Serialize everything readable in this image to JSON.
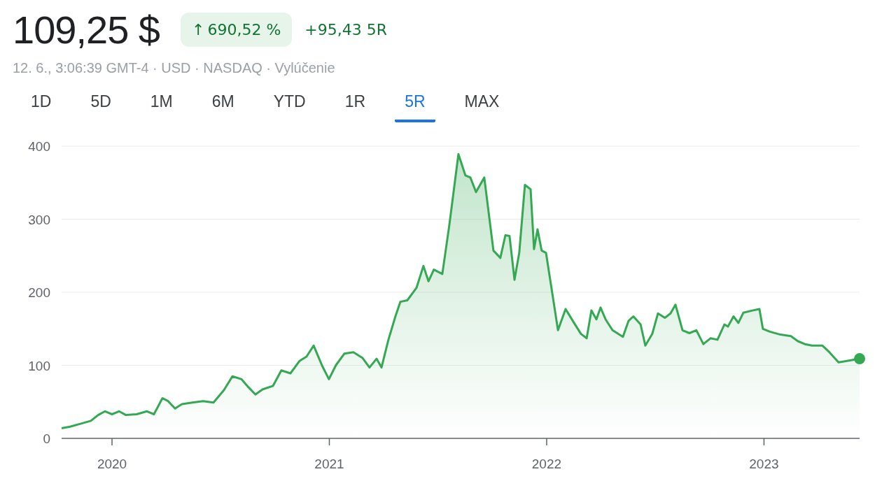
{
  "quote": {
    "price": "109,25 $",
    "change_percent": "690,52 %",
    "change_percent_arrow": "↑",
    "change_value": "+95,43 5R",
    "subtitle": "12. 6., 3:06:39 GMT-4 · USD · NASDAQ · Vylúčenie"
  },
  "tabs": [
    {
      "label": "1D",
      "selected": false
    },
    {
      "label": "5D",
      "selected": false
    },
    {
      "label": "1M",
      "selected": false
    },
    {
      "label": "6M",
      "selected": false
    },
    {
      "label": "YTD",
      "selected": false
    },
    {
      "label": "1R",
      "selected": false
    },
    {
      "label": "5R",
      "selected": true
    },
    {
      "label": "MAX",
      "selected": false
    }
  ],
  "chart": {
    "chart_data": {
      "type": "area",
      "grid": true,
      "xlim": [
        2019.768,
        2023.44
      ],
      "ylim": [
        0,
        400
      ],
      "yticks": [
        0,
        100,
        200,
        300,
        400
      ],
      "xticks": [
        2020,
        2021,
        2022,
        2023
      ],
      "x": [
        2019.768,
        2019.807,
        2019.855,
        2019.903,
        2019.936,
        2019.968,
        2020.0,
        2020.032,
        2020.064,
        2020.113,
        2020.161,
        2020.193,
        2020.232,
        2020.258,
        2020.29,
        2020.322,
        2020.37,
        2020.419,
        2020.467,
        2020.515,
        2020.554,
        2020.596,
        2020.628,
        2020.66,
        2020.692,
        2020.741,
        2020.779,
        2020.821,
        2020.863,
        2020.895,
        2020.928,
        2020.966,
        2020.998,
        2021.03,
        2021.069,
        2021.111,
        2021.153,
        2021.185,
        2021.217,
        2021.24,
        2021.272,
        2021.304,
        2021.327,
        2021.359,
        2021.401,
        2021.433,
        2021.456,
        2021.481,
        2021.52,
        2021.552,
        2021.594,
        2021.626,
        2021.649,
        2021.675,
        2021.713,
        2021.755,
        2021.787,
        2021.81,
        2021.829,
        2021.852,
        2021.874,
        2021.9,
        2021.926,
        2021.942,
        2021.958,
        2021.977,
        2021.997,
        2022.023,
        2022.052,
        2022.087,
        2022.126,
        2022.158,
        2022.184,
        2022.206,
        2022.229,
        2022.248,
        2022.271,
        2022.303,
        2022.351,
        2022.377,
        2022.399,
        2022.432,
        2022.454,
        2022.486,
        2022.512,
        2022.544,
        2022.57,
        2022.593,
        2022.625,
        2022.657,
        2022.689,
        2022.721,
        2022.754,
        2022.786,
        2022.818,
        2022.834,
        2022.86,
        2022.882,
        2022.905,
        2022.947,
        2022.979,
        2022.995,
        2023.027,
        2023.076,
        2023.124,
        2023.156,
        2023.188,
        2023.221,
        2023.269,
        2023.301,
        2023.343,
        2023.382,
        2023.44
      ],
      "series": [
        {
          "color": "#34a853",
          "values": [
            14,
            16,
            20,
            24,
            32,
            37,
            33,
            37,
            32,
            33,
            37,
            33,
            55,
            51,
            41,
            47,
            49,
            51,
            49,
            66,
            85,
            81,
            70,
            60,
            67,
            72,
            93,
            89,
            106,
            112,
            127,
            100,
            81,
            100,
            116,
            118,
            110,
            97,
            109,
            97,
            135,
            167,
            187,
            189,
            206,
            236,
            215,
            231,
            225,
            292,
            389,
            360,
            357,
            337,
            357,
            257,
            247,
            278,
            277,
            217,
            254,
            347,
            341,
            259,
            286,
            257,
            254,
            204,
            148,
            177,
            158,
            143,
            137,
            175,
            163,
            179,
            163,
            148,
            139,
            161,
            167,
            156,
            127,
            143,
            171,
            165,
            171,
            183,
            148,
            144,
            148,
            129,
            137,
            135,
            156,
            153,
            167,
            158,
            172,
            175,
            177,
            150,
            146,
            142,
            140,
            133,
            129,
            127,
            127,
            118,
            104,
            106,
            109
          ]
        }
      ]
    }
  }
}
